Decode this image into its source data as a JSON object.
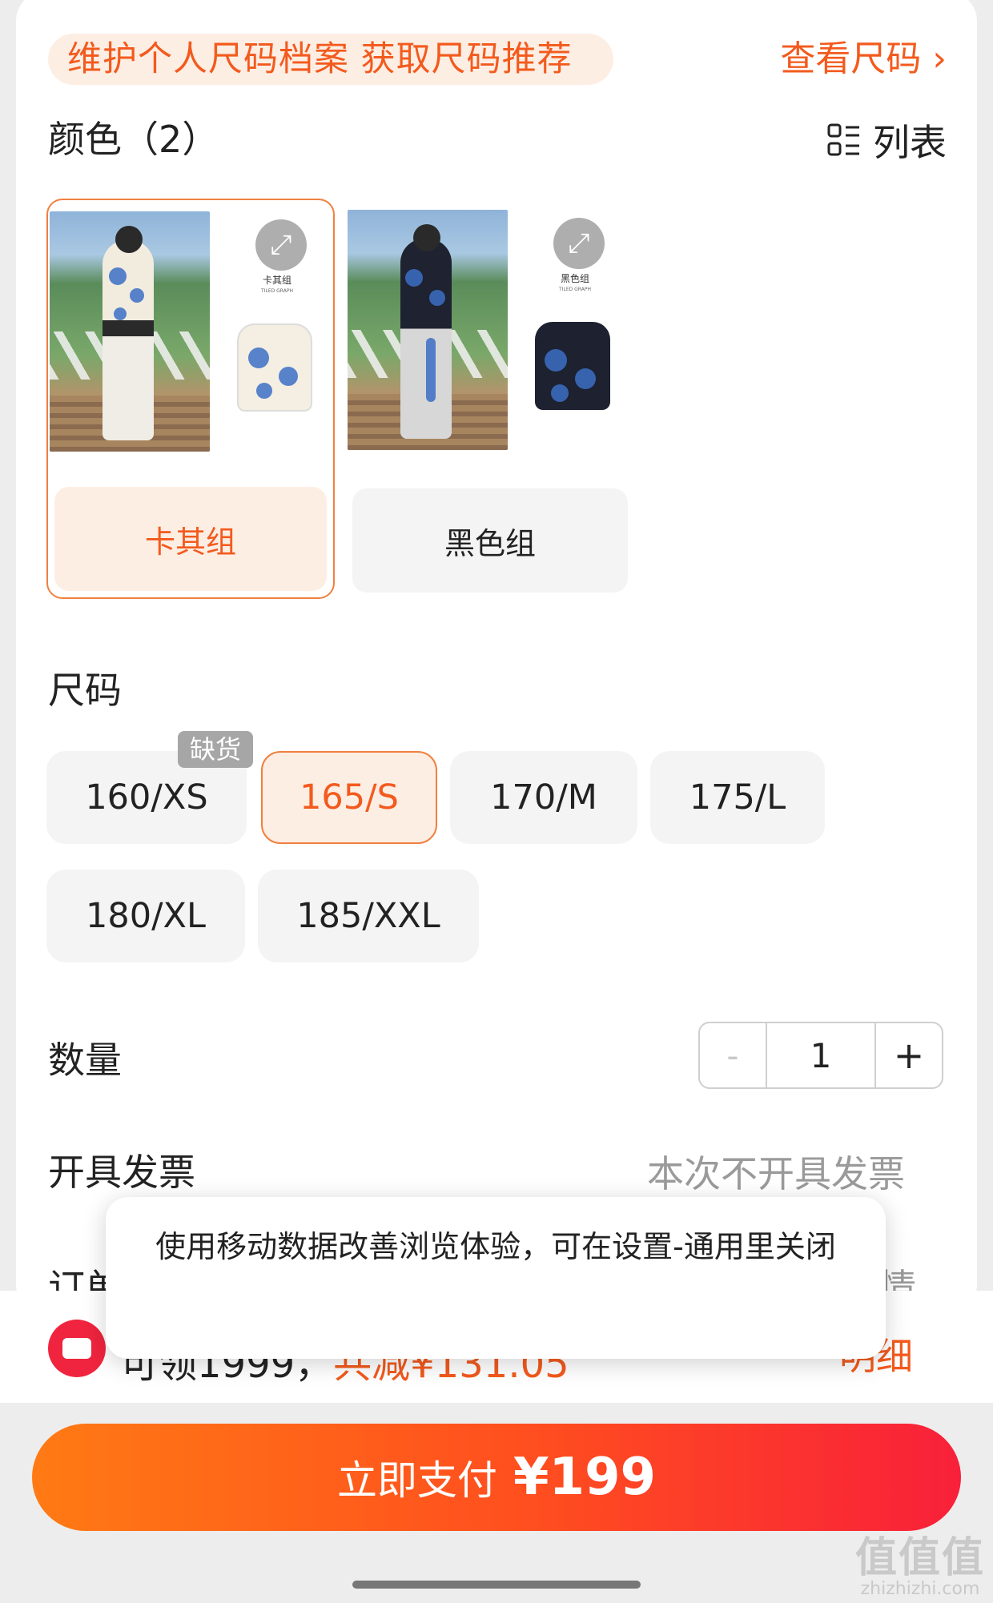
{
  "banner": {
    "text": "维护个人尺码档案 获取尺码推荐",
    "link": "查看尺码",
    "link_arrow": "›"
  },
  "colors": {
    "title": "颜色（2）",
    "view_toggle": "列表",
    "options": [
      {
        "name": "卡其组",
        "tile_label": "卡其组",
        "tile_sub": "TILED GRAPH",
        "selected": true
      },
      {
        "name": "黑色组",
        "tile_label": "黑色组",
        "tile_sub": "TILED GRAPH",
        "selected": false
      }
    ]
  },
  "sizes": {
    "title": "尺码",
    "options": [
      {
        "label": "160/XS",
        "badge": "缺货",
        "selected": false
      },
      {
        "label": "165/S",
        "selected": true
      },
      {
        "label": "170/M",
        "selected": false
      },
      {
        "label": "175/L",
        "selected": false
      },
      {
        "label": "180/XL",
        "selected": false
      },
      {
        "label": "185/XXL",
        "selected": false
      }
    ]
  },
  "quantity": {
    "title": "数量",
    "minus": "-",
    "value": "1",
    "plus": "+"
  },
  "invoice": {
    "title": "开具发票",
    "value": "本次不开具发票"
  },
  "order_row_peek": {
    "left": "订单",
    "right": "详情"
  },
  "discount_row": {
    "left_text": "可领1999，",
    "highlight": "共减¥131.05",
    "right": "明细"
  },
  "toast": {
    "message": "使用移动数据改善浏览体验，可在设置-通用里关闭"
  },
  "pay_button": {
    "label": "立即支付",
    "price": "¥199"
  },
  "watermark": {
    "big": "值值值",
    "small": "zhizhizhi.com"
  },
  "theme": {
    "accent": "#f35a1d",
    "accent_bg": "#fdeee4",
    "danger": "#f0243e"
  }
}
